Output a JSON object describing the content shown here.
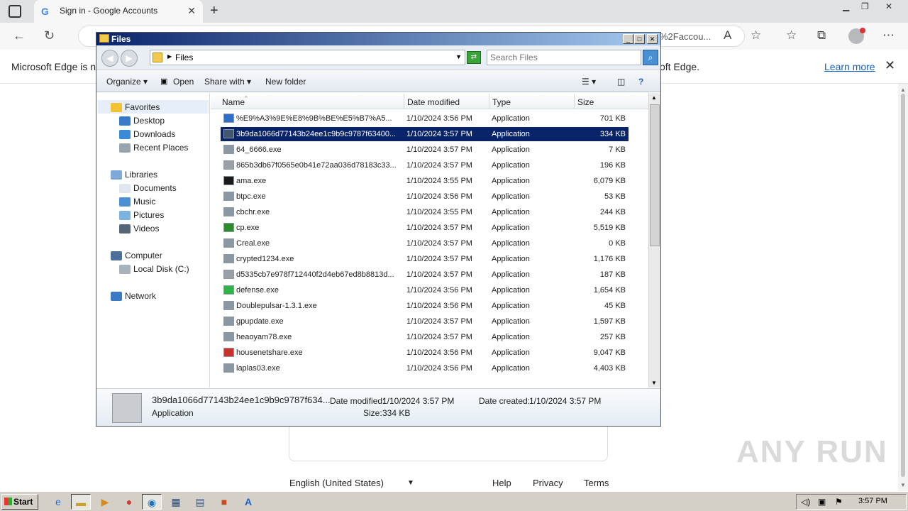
{
  "browser": {
    "tab_title": "Sign in - Google Accounts",
    "address_tail": "%2Faccou...",
    "infobar_left": "Microsoft Edge is no",
    "infobar_right": "oft Edge.",
    "learn_more": "Learn more"
  },
  "google_footer": {
    "language": "English (United States)",
    "links": [
      "Help",
      "Privacy",
      "Terms"
    ]
  },
  "watermark": "ANY RUN",
  "explorer": {
    "title": "Files",
    "path": "Files",
    "search_placeholder": "Search Files",
    "commands": [
      "Organize",
      "Open",
      "Share with",
      "New folder"
    ],
    "nav": {
      "favorites": "Favorites",
      "favorites_items": [
        "Desktop",
        "Downloads",
        "Recent Places"
      ],
      "libraries": "Libraries",
      "libraries_items": [
        "Documents",
        "Music",
        "Pictures",
        "Videos"
      ],
      "computer": "Computer",
      "computer_items": [
        "Local Disk (C:)"
      ],
      "network": "Network"
    },
    "columns": [
      "Name",
      "Date modified",
      "Type",
      "Size"
    ],
    "files": [
      {
        "name": "%E9%A3%9E%E8%9B%BE%E5%B7%A5...",
        "date": "1/10/2024 3:56 PM",
        "type": "Application",
        "size": "701 KB"
      },
      {
        "name": "3b9da1066d77143b24ee1c9b9c9787f63400...",
        "date": "1/10/2024 3:57 PM",
        "type": "Application",
        "size": "334 KB",
        "selected": true
      },
      {
        "name": "64_6666.exe",
        "date": "1/10/2024 3:57 PM",
        "type": "Application",
        "size": "7 KB"
      },
      {
        "name": "865b3db67f0565e0b41e72aa036d78183c33...",
        "date": "1/10/2024 3:57 PM",
        "type": "Application",
        "size": "196 KB"
      },
      {
        "name": "ama.exe",
        "date": "1/10/2024 3:55 PM",
        "type": "Application",
        "size": "6,079 KB"
      },
      {
        "name": "btpc.exe",
        "date": "1/10/2024 3:56 PM",
        "type": "Application",
        "size": "53 KB"
      },
      {
        "name": "cbchr.exe",
        "date": "1/10/2024 3:55 PM",
        "type": "Application",
        "size": "244 KB"
      },
      {
        "name": "cp.exe",
        "date": "1/10/2024 3:57 PM",
        "type": "Application",
        "size": "5,519 KB"
      },
      {
        "name": "Creal.exe",
        "date": "1/10/2024 3:57 PM",
        "type": "Application",
        "size": "0 KB"
      },
      {
        "name": "crypted1234.exe",
        "date": "1/10/2024 3:57 PM",
        "type": "Application",
        "size": "1,176 KB"
      },
      {
        "name": "d5335cb7e978f712440f2d4eb67ed8b8813d...",
        "date": "1/10/2024 3:57 PM",
        "type": "Application",
        "size": "187 KB"
      },
      {
        "name": "defense.exe",
        "date": "1/10/2024 3:56 PM",
        "type": "Application",
        "size": "1,654 KB"
      },
      {
        "name": "Doublepulsar-1.3.1.exe",
        "date": "1/10/2024 3:56 PM",
        "type": "Application",
        "size": "45 KB"
      },
      {
        "name": "gpupdate.exe",
        "date": "1/10/2024 3:57 PM",
        "type": "Application",
        "size": "1,597 KB"
      },
      {
        "name": "heaoyam78.exe",
        "date": "1/10/2024 3:57 PM",
        "type": "Application",
        "size": "257 KB"
      },
      {
        "name": "housenetshare.exe",
        "date": "1/10/2024 3:56 PM",
        "type": "Application",
        "size": "9,047 KB"
      },
      {
        "name": "laplas03.exe",
        "date": "1/10/2024 3:56 PM",
        "type": "Application",
        "size": "4,403 KB"
      }
    ],
    "details": {
      "name": "3b9da1066d77143b24ee1c9b9c9787f634...",
      "type": "Application",
      "modified_label": "Date modified:",
      "modified": "1/10/2024 3:57 PM",
      "created_label": "Date created:",
      "created": "1/10/2024 3:57 PM",
      "size_label": "Size:",
      "size": "334 KB"
    }
  },
  "taskbar": {
    "start": "Start",
    "clock": "3:57 PM"
  }
}
